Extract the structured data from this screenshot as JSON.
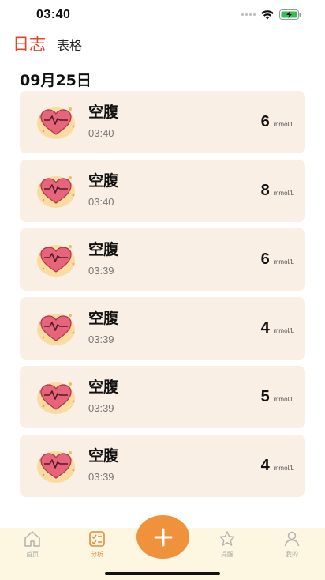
{
  "status_bar": {
    "time": "03:40"
  },
  "header": {
    "tab_log": "日志",
    "tab_table": "表格"
  },
  "date_title": "09月25日",
  "records": [
    {
      "label": "空腹",
      "time": "03:40",
      "value": "6",
      "unit": "mmol/L"
    },
    {
      "label": "空腹",
      "time": "03:40",
      "value": "8",
      "unit": "mmol/L"
    },
    {
      "label": "空腹",
      "time": "03:39",
      "value": "6",
      "unit": "mmol/L"
    },
    {
      "label": "空腹",
      "time": "03:39",
      "value": "4",
      "unit": "mmol/L"
    },
    {
      "label": "空腹",
      "time": "03:39",
      "value": "5",
      "unit": "mmol/L"
    },
    {
      "label": "空腹",
      "time": "03:39",
      "value": "4",
      "unit": "mmol/L"
    }
  ],
  "tab_bar": {
    "home": "首页",
    "analysis": "分析",
    "reminder": "提醒",
    "mine": "我的"
  },
  "colors": {
    "accent": "#e0462a",
    "card_bg": "#faefe4",
    "fab": "#f0913b",
    "tab_bar_bg": "#fdf7e2",
    "tab_active": "#e48a3c"
  },
  "icons": {
    "record": "heart-pulse-icon",
    "home": "home-icon",
    "analysis": "checklist-icon",
    "add": "plus-icon",
    "reminder": "star-icon",
    "mine": "person-icon"
  }
}
